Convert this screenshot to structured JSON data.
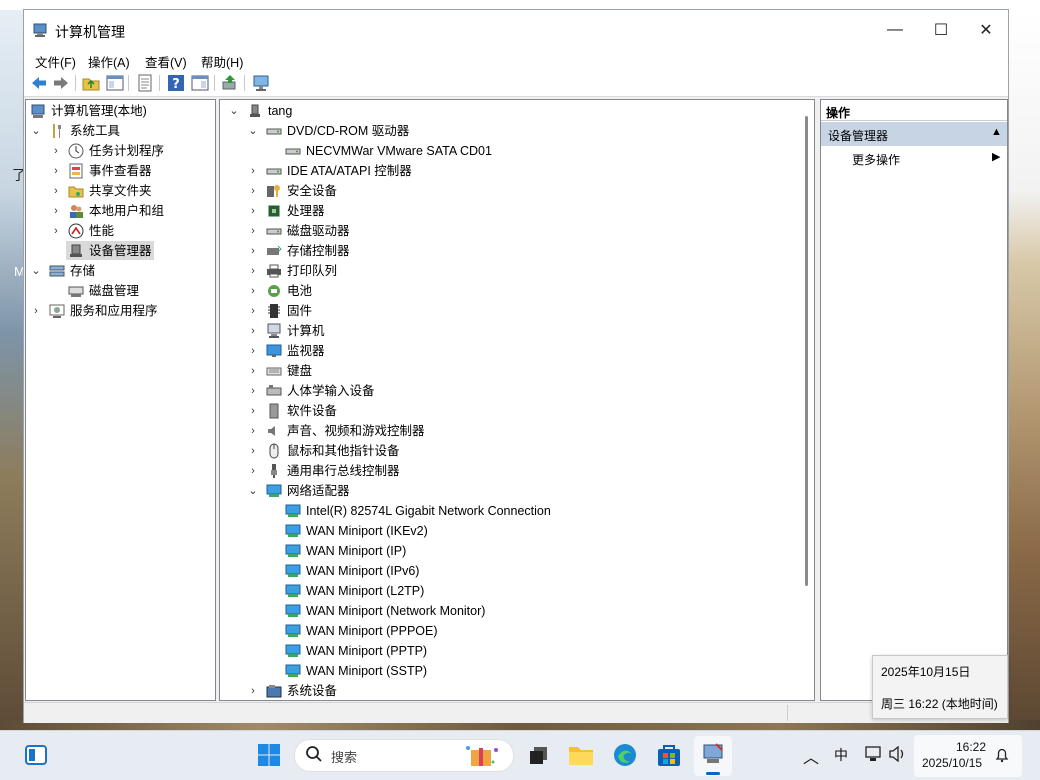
{
  "window": {
    "title": "计算机管理",
    "controls": {
      "minimize": "—",
      "maximize": "☐",
      "close": "✕"
    }
  },
  "menu": [
    "文件(F)",
    "操作(A)",
    "查看(V)",
    "帮助(H)"
  ],
  "left_tree": {
    "root": "计算机管理(本地)",
    "system_tools": "系统工具",
    "items": [
      "任务计划程序",
      "事件查看器",
      "共享文件夹",
      "本地用户和组",
      "性能",
      "设备管理器"
    ],
    "storage": "存储",
    "disk_mgmt": "磁盘管理",
    "services": "服务和应用程序"
  },
  "device_tree": {
    "root": "tang",
    "dvd": "DVD/CD-ROM 驱动器",
    "dvd_child": "NECVMWar VMware SATA CD01",
    "categories": [
      "IDE ATA/ATAPI 控制器",
      "安全设备",
      "处理器",
      "磁盘驱动器",
      "存储控制器",
      "打印队列",
      "电池",
      "固件",
      "计算机",
      "监视器",
      "键盘",
      "人体学输入设备",
      "软件设备",
      "声音、视频和游戏控制器",
      "鼠标和其他指针设备",
      "通用串行总线控制器"
    ],
    "network": "网络适配器",
    "network_children": [
      "Intel(R) 82574L Gigabit Network Connection",
      "WAN Miniport (IKEv2)",
      "WAN Miniport (IP)",
      "WAN Miniport (IPv6)",
      "WAN Miniport (L2TP)",
      "WAN Miniport (Network Monitor)",
      "WAN Miniport (PPPOE)",
      "WAN Miniport (PPTP)",
      "WAN Miniport (SSTP)"
    ],
    "system_devices": "系统设备"
  },
  "actions": {
    "header": "操作",
    "section": "设备管理器",
    "more": "更多操作"
  },
  "tooltip": {
    "date": "2025年10月15日",
    "time": "周三 16:22 (本地时间)"
  },
  "taskbar": {
    "search_placeholder": "搜索",
    "ime": "中",
    "clock_time": "16:22",
    "clock_date": "2025/10/15"
  },
  "desktop": {
    "glyph1": "了",
    "glyph2": "M"
  }
}
